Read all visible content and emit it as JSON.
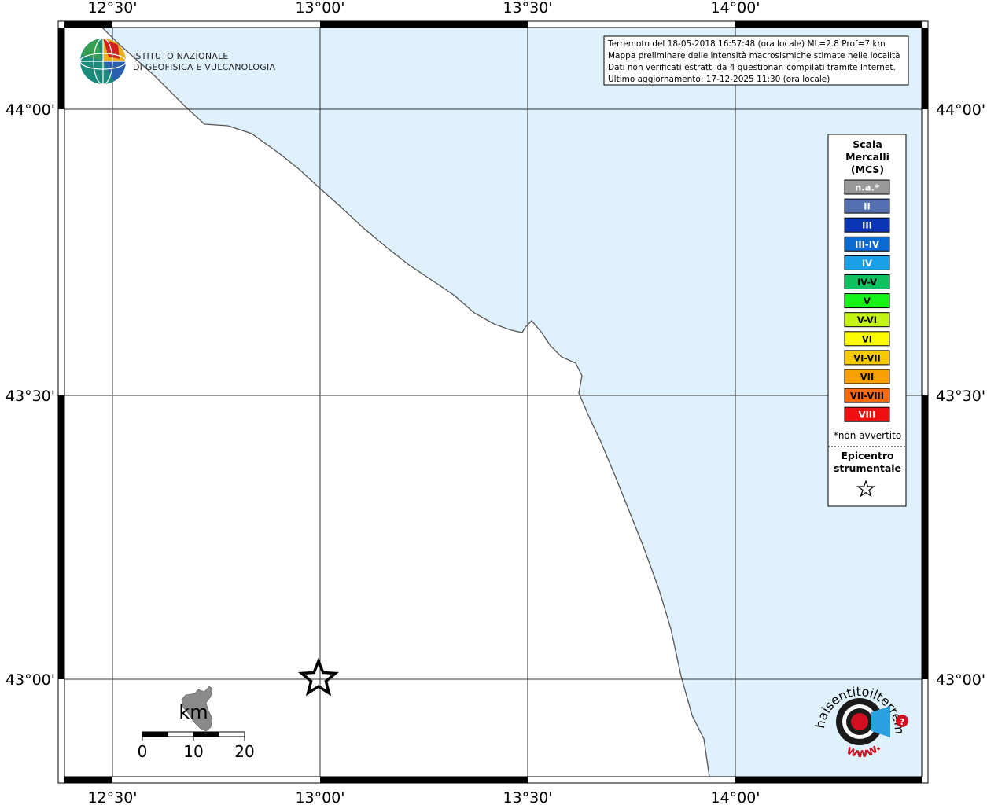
{
  "map": {
    "lon_ticks": [
      "12°30'",
      "13°00'",
      "13°30'",
      "14°00'"
    ],
    "lat_ticks": [
      "44°00'",
      "43°30'",
      "43°00'"
    ]
  },
  "info_box": {
    "lines": [
      "Terremoto del 18-05-2018 16:57:48 (ora locale) ML=2.8 Prof=7 km",
      "Mappa preliminare delle intensità macrosismiche stimate nelle località",
      "Dati non verificati estratti da 4 questionari compilati tramite Internet.",
      "Ultimo aggiornamento: 17-12-2025 11:30 (ora locale)"
    ]
  },
  "legend": {
    "title_lines": [
      "Scala",
      "Mercalli",
      "(MCS)"
    ],
    "items": [
      {
        "label": "n.a.*",
        "color": "#999999",
        "text_color": "#ffffff"
      },
      {
        "label": "II",
        "color": "#5470b0",
        "text_color": "#ffffff"
      },
      {
        "label": "III",
        "color": "#0a35b5",
        "text_color": "#ffffff"
      },
      {
        "label": "III-IV",
        "color": "#0a6ad0",
        "text_color": "#ffffff"
      },
      {
        "label": "IV",
        "color": "#1aa0e6",
        "text_color": "#ffffff"
      },
      {
        "label": "IV-V",
        "color": "#0ec060",
        "text_color": "#000000"
      },
      {
        "label": "V",
        "color": "#16f41a",
        "text_color": "#000000"
      },
      {
        "label": "V-VI",
        "color": "#c4f412",
        "text_color": "#000000"
      },
      {
        "label": "VI",
        "color": "#fafa00",
        "text_color": "#000000"
      },
      {
        "label": "VI-VII",
        "color": "#f8c800",
        "text_color": "#000000"
      },
      {
        "label": "VII",
        "color": "#f8a000",
        "text_color": "#000000"
      },
      {
        "label": "VII-VIII",
        "color": "#f86a0a",
        "text_color": "#000000"
      },
      {
        "label": "VIII",
        "color": "#f01010",
        "text_color": "#ffffff"
      }
    ],
    "note": "*non avvertito",
    "epicenter_lines": [
      "Epicentro",
      "strumentale"
    ],
    "epicenter_symbol": "star-icon"
  },
  "scale_bar": {
    "unit": "km",
    "labels": [
      "0",
      "10",
      "20"
    ]
  },
  "logos": {
    "ingv_lines": [
      "ISTITUTO NAZIONALE",
      "DI GEOFISICA E VULCANOLOGIA"
    ],
    "hsit_text": "haisentitoilterremoto.it",
    "hsit_url": "www."
  },
  "colors": {
    "sea": "#dff1fd",
    "land": "#ffffff",
    "coast": "#555555"
  }
}
